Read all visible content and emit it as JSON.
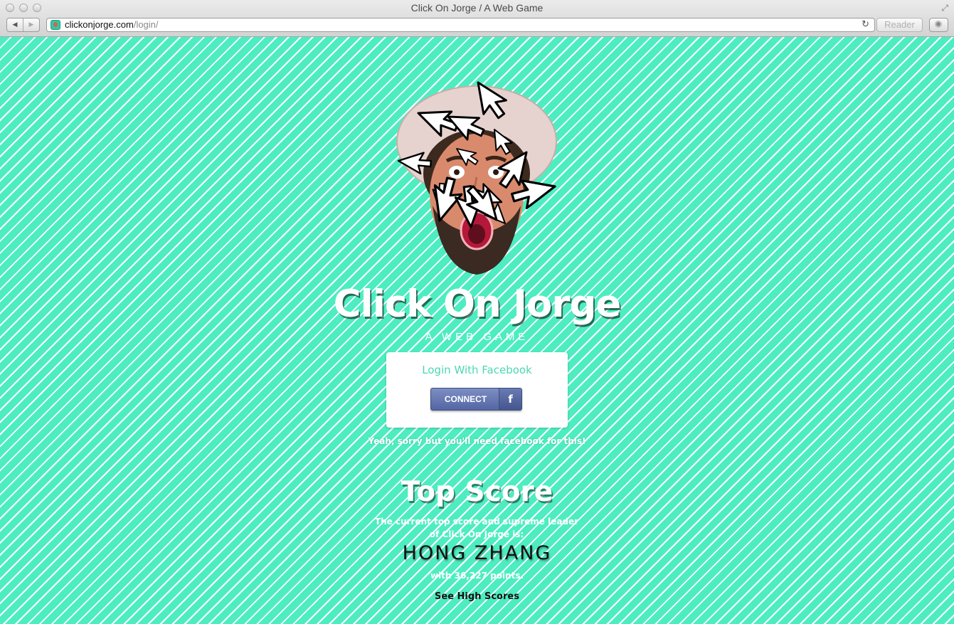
{
  "window": {
    "title": "Click On Jorge / A Web Game"
  },
  "browser": {
    "url_host": "clickonjorge.com",
    "url_path": "/login/",
    "reader_label": "Reader",
    "back_icon": "◀",
    "forward_icon": "▶",
    "reload_icon": "↻",
    "fullscreen_icon": "⤢"
  },
  "hero": {
    "title": "Click On Jorge",
    "subtitle": "A WEB GAME"
  },
  "login": {
    "label": "Login With Facebook",
    "connect_label": "CONNECT",
    "fb_glyph": "f",
    "note": "Yeah, sorry but you'll need facebook for this!"
  },
  "top_score": {
    "heading": "Top Score",
    "description": "The current top score and supreme leader of Click On Jorge is:",
    "leader": "HONG ZHANG",
    "points_text": "with 36,227 points.",
    "link_label": "See High Scores"
  },
  "colors": {
    "background": "#4dedc1",
    "stripe": "#ffffff",
    "accent_text": "#4bd8b3",
    "facebook": "#5466a3"
  }
}
